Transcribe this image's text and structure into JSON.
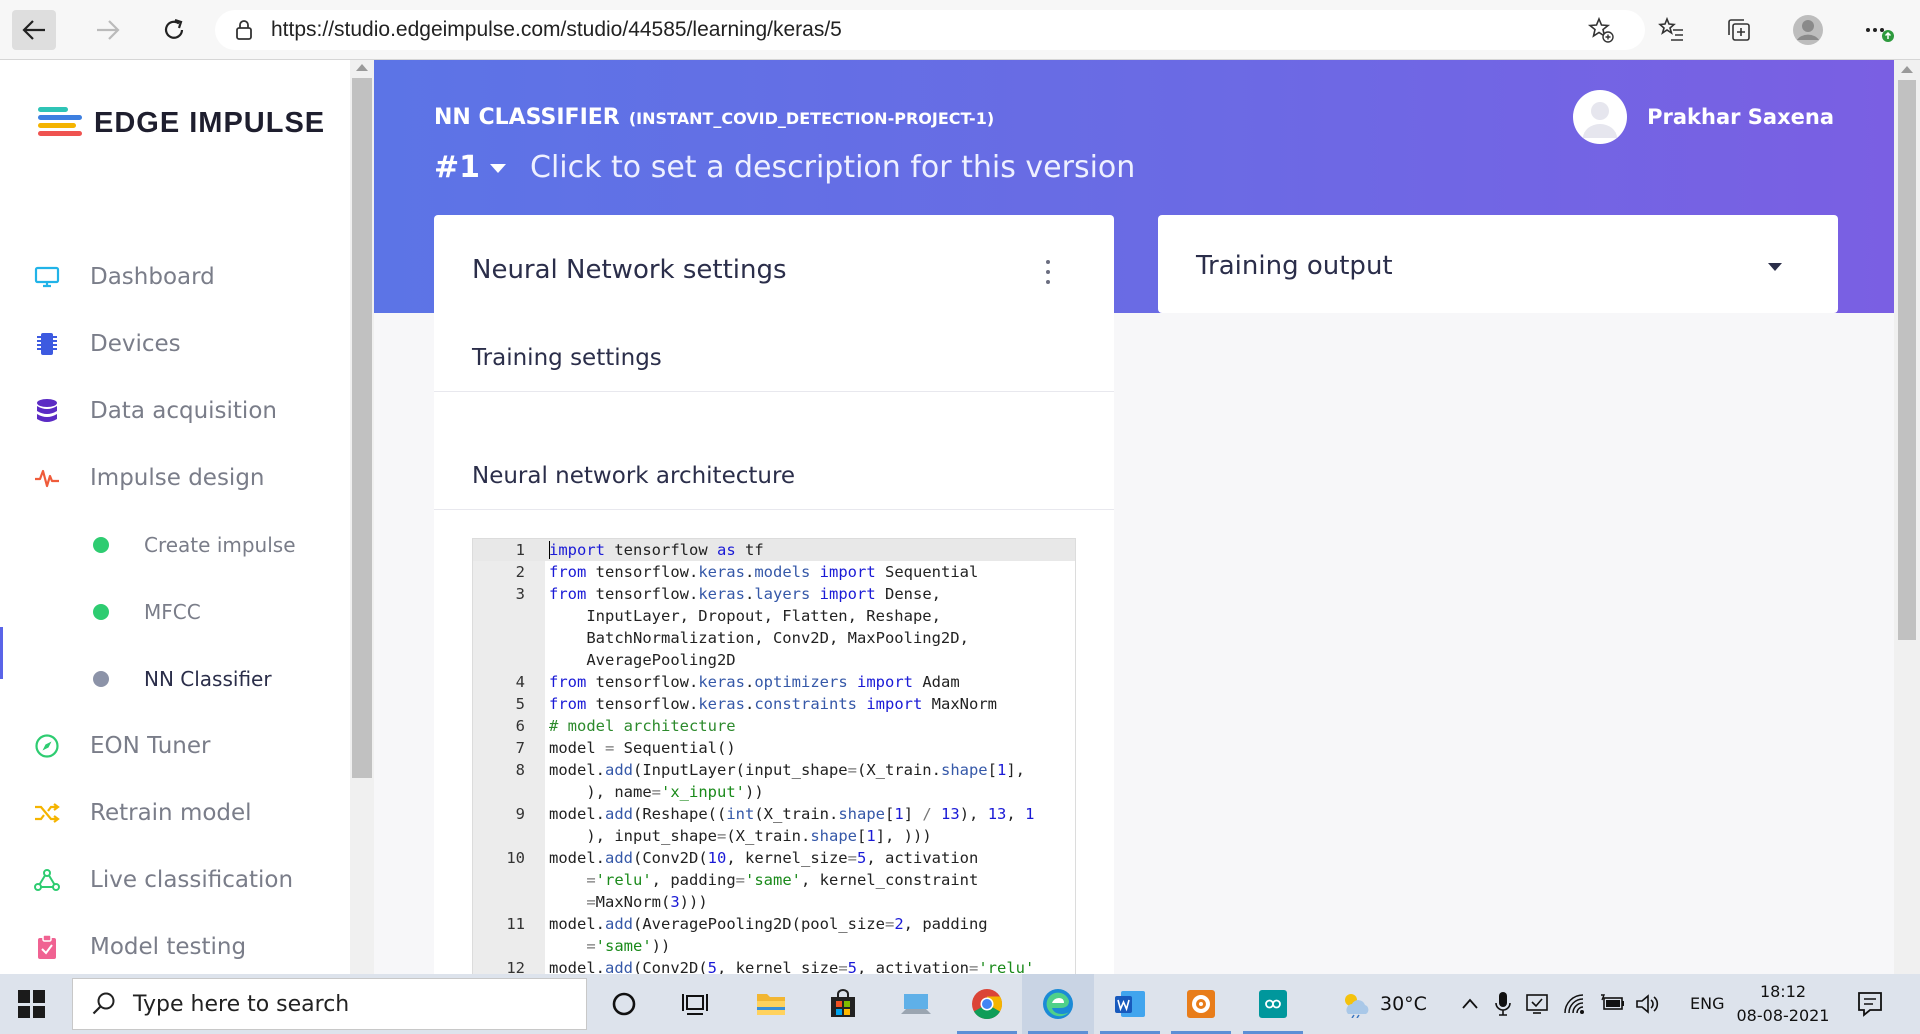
{
  "browser": {
    "url": "https://studio.edgeimpulse.com/studio/44585/learning/keras/5"
  },
  "app": {
    "logo_text": "EDGE IMPULSE",
    "brand_color": "#6b6ae4"
  },
  "sidebar": {
    "items": [
      {
        "label": "Dashboard",
        "icon": "monitor-icon"
      },
      {
        "label": "Devices",
        "icon": "chip-icon"
      },
      {
        "label": "Data acquisition",
        "icon": "database-icon"
      },
      {
        "label": "Impulse design",
        "icon": "pulse-icon"
      },
      {
        "label": "Create impulse",
        "icon": "green-dot"
      },
      {
        "label": "MFCC",
        "icon": "green-dot"
      },
      {
        "label": "NN Classifier",
        "icon": "grey-dot"
      },
      {
        "label": "EON Tuner",
        "icon": "compass-icon"
      },
      {
        "label": "Retrain model",
        "icon": "shuffle-icon"
      },
      {
        "label": "Live classification",
        "icon": "network-icon"
      },
      {
        "label": "Model testing",
        "icon": "clipboard-icon"
      }
    ],
    "active": "NN Classifier"
  },
  "header": {
    "title": "NN CLASSIFIER",
    "project": "(INSTANT_COVID_DETECTION-PROJECT-1)",
    "version": "#1",
    "version_description": "Click to set a description for this version",
    "user_name": "Prakhar Saxena"
  },
  "nn_card": {
    "title": "Neural Network settings",
    "training_settings": "Training settings",
    "architecture_title": "Neural network architecture"
  },
  "output_card": {
    "title": "Training output"
  },
  "code": {
    "line_numbers": [
      "1",
      "2",
      "3",
      "4",
      "5",
      "6",
      "7",
      "8",
      "9",
      "10",
      "11",
      "12"
    ]
  },
  "taskbar": {
    "search_placeholder": "Type here to search",
    "weather": "30°C",
    "language": "ENG",
    "time": "18:12",
    "date": "08-08-2021"
  }
}
